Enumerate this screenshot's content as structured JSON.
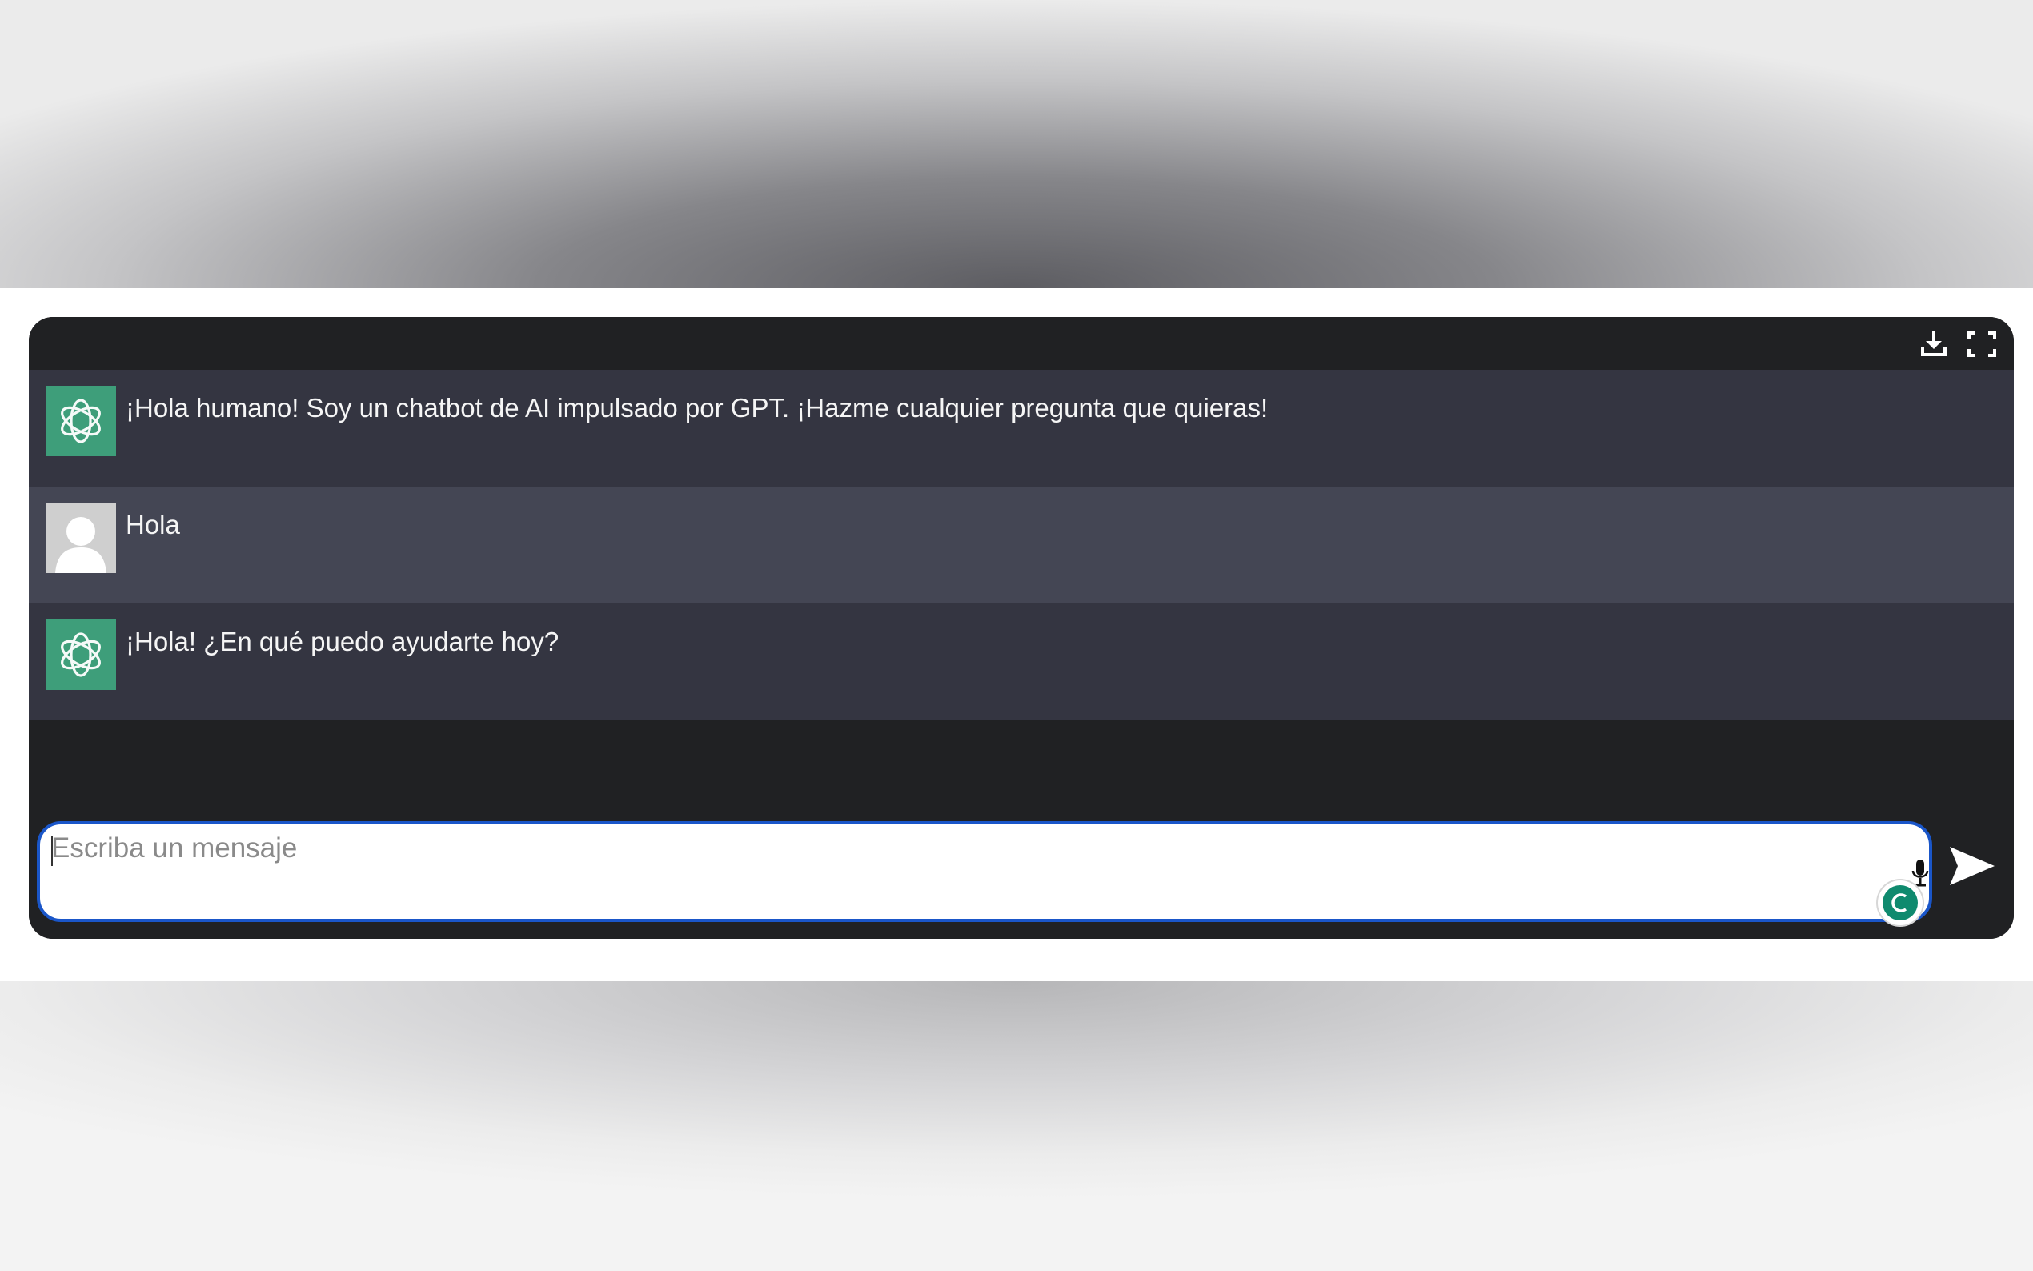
{
  "chat": {
    "toolbar": {
      "download_icon": "download-icon",
      "fullscreen_icon": "fullscreen-icon"
    },
    "messages": [
      {
        "role": "bot",
        "avatar_icon": "openai-logo-icon",
        "text": "¡Hola humano! Soy un chatbot de AI impulsado por GPT. ¡Hazme cualquier pregunta que quieras!"
      },
      {
        "role": "user",
        "avatar_icon": "user-avatar-icon",
        "text": "Hola"
      },
      {
        "role": "bot",
        "avatar_icon": "openai-logo-icon",
        "text": "¡Hola! ¿En qué puedo ayudarte hoy?"
      }
    ],
    "input": {
      "value": "",
      "placeholder": "Escriba un mensaje",
      "mic_icon": "microphone-icon",
      "grammarly_icon": "grammarly-icon",
      "send_icon": "send-icon"
    },
    "colors": {
      "widget_bg": "#202123",
      "bot_row_bg": "#343541",
      "user_row_bg": "#444654",
      "bot_avatar_bg": "#3e9e7a",
      "input_border": "#1a56c9"
    }
  }
}
